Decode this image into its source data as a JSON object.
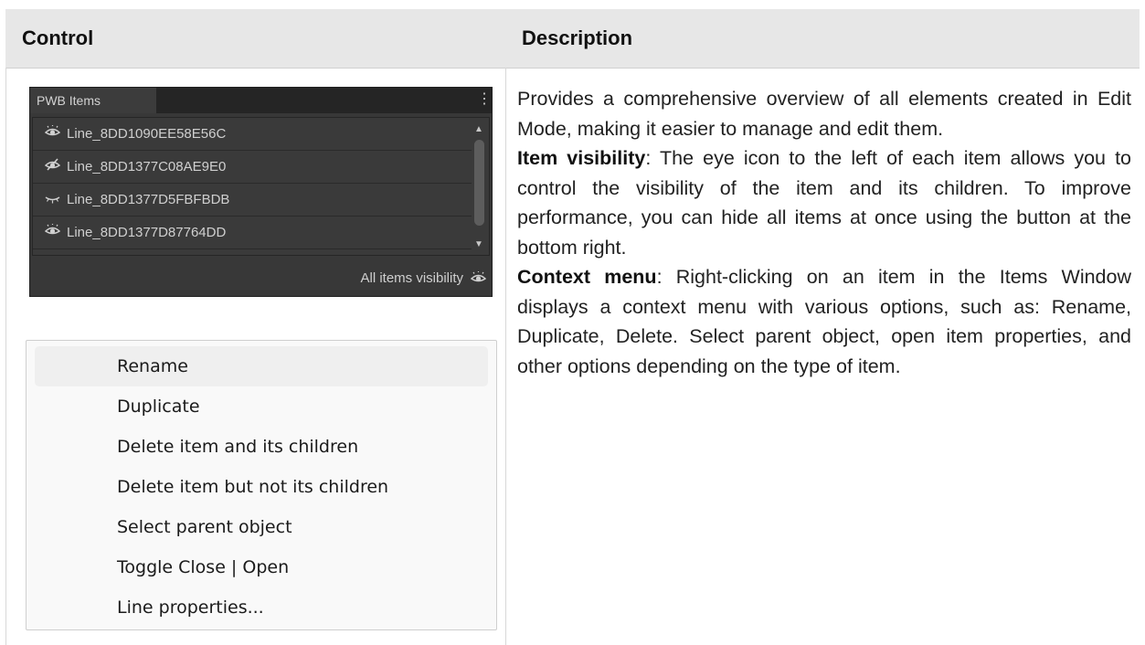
{
  "table": {
    "col_control": "Control",
    "col_description": "Description"
  },
  "pwb_panel": {
    "tab_label": "PWB Items",
    "menu_glyph": "⋮",
    "items": [
      {
        "label": "Line_8DD1090EE58E56C",
        "icon": "eye-open-icon"
      },
      {
        "label": "Line_8DD1377C08AE9E0",
        "icon": "eye-hidden-icon"
      },
      {
        "label": "Line_8DD1377D5FBFBDB",
        "icon": "eye-closed-icon"
      },
      {
        "label": "Line_8DD1377D87764DD",
        "icon": "eye-open-icon"
      }
    ],
    "footer_label": "All items visibility"
  },
  "context_menu": {
    "items": [
      "Rename",
      "Duplicate",
      "Delete item and its children",
      "Delete item but not its children",
      "Select parent object",
      "Toggle Close | Open",
      "Line properties..."
    ]
  },
  "description": {
    "intro": "Provides a comprehensive overview of all elements created in Edit Mode, making it easier to manage and edit them.",
    "visibility_title": "Item visibility",
    "visibility_text": ": The eye icon to the left of each item allows you to control the visibility of the item and its children. To improve performance, you can hide all items at once using the button at the bottom right.",
    "context_title": "Context menu",
    "context_text": ": Right-clicking on an item in the Items Window displays a context menu with various options, such as: Rename, Duplicate, Delete. Select parent object,  open item properties, and other options depending on the type of item."
  }
}
